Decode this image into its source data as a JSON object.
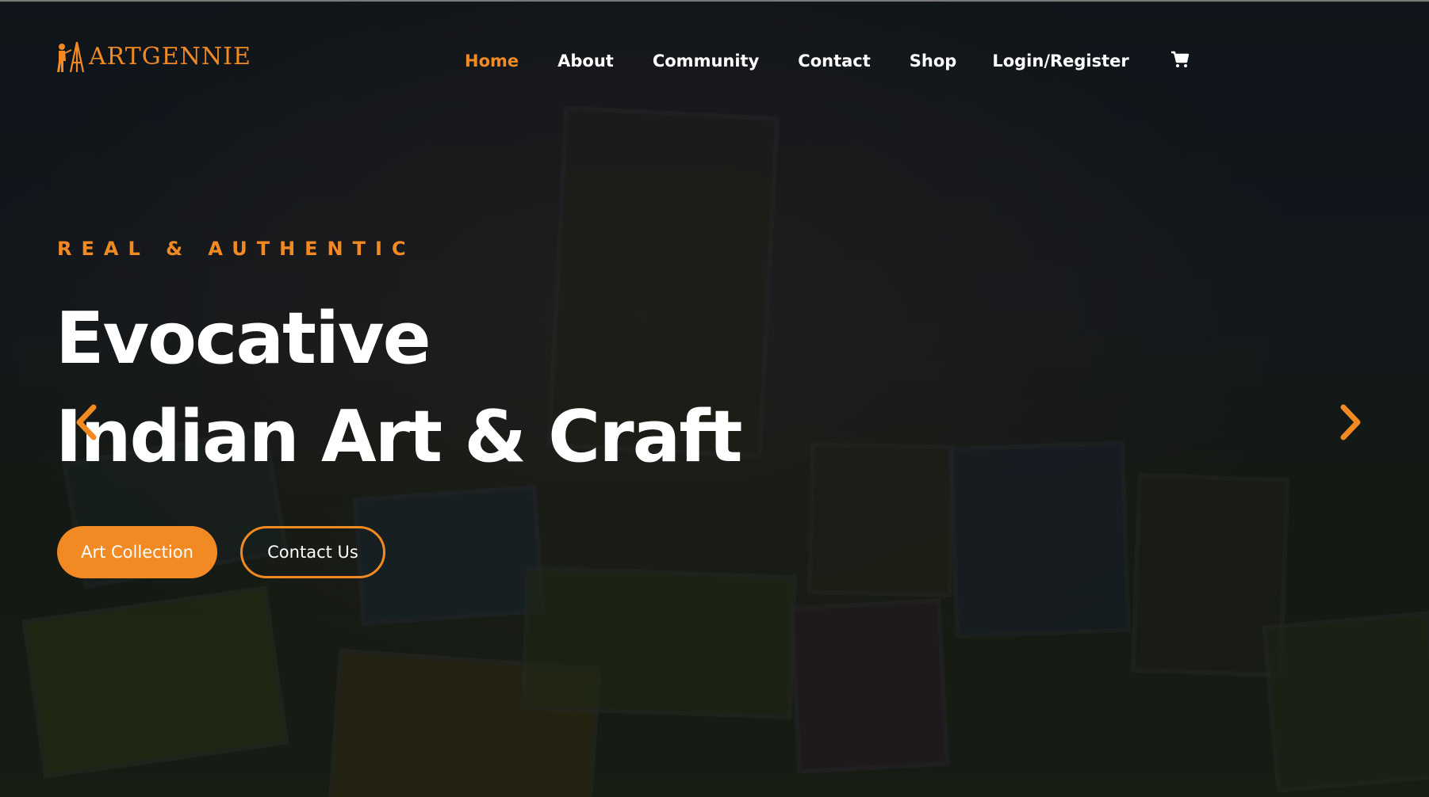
{
  "brand": {
    "name": "ARTGENNIE",
    "accent_color": "#f28a24",
    "logo_icon": "painter-easel-icon"
  },
  "nav": {
    "items": [
      {
        "label": "Home",
        "active": true
      },
      {
        "label": "About",
        "active": false
      },
      {
        "label": "Community",
        "active": false
      },
      {
        "label": "Contact",
        "active": false
      },
      {
        "label": "Shop",
        "active": false
      },
      {
        "label": "Login/Register",
        "active": false
      }
    ],
    "cart_icon": "shopping-cart-icon"
  },
  "hero": {
    "eyebrow": "REAL & AUTHENTIC",
    "headline_line1": "Evocative",
    "headline_line2": "Indian Art & Craft",
    "primary_button": "Art Collection",
    "secondary_button": "Contact Us",
    "prev_icon": "chevron-left-icon",
    "next_icon": "chevron-right-icon"
  }
}
